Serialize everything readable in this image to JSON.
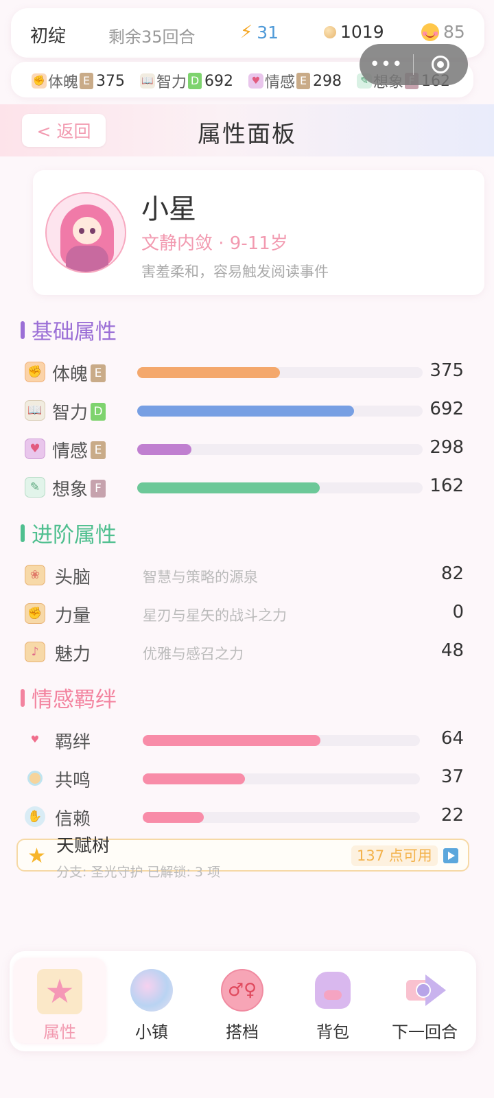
{
  "status": {
    "name": "初绽",
    "rounds": "剩余35回合",
    "energy": "31",
    "coins": "1019",
    "mood": "85"
  },
  "strip": [
    {
      "label": "体魄",
      "grade": "E",
      "value": "375"
    },
    {
      "label": "智力",
      "grade": "D",
      "value": "692"
    },
    {
      "label": "情感",
      "grade": "E",
      "value": "298"
    },
    {
      "label": "想象",
      "grade": "F",
      "value": "162"
    }
  ],
  "header": {
    "back_label": "< 返回",
    "title": "属性面板"
  },
  "profile": {
    "name": "小星",
    "type": "文静内敛 · 9-11岁",
    "desc": "害羞柔和，容易触发阅读事件"
  },
  "basic": {
    "title": "基础属性",
    "rows": [
      {
        "label": "体魄",
        "grade": "E",
        "value": "375",
        "fraction": 0.5
      },
      {
        "label": "智力",
        "grade": "D",
        "value": "692",
        "fraction": 0.76
      },
      {
        "label": "情感",
        "grade": "E",
        "value": "298",
        "fraction": 0.19
      },
      {
        "label": "想象",
        "grade": "F",
        "value": "162",
        "fraction": 0.64
      }
    ]
  },
  "advanced": {
    "title": "进阶属性",
    "rows": [
      {
        "label": "头脑",
        "desc": "智慧与策略的源泉",
        "value": "82"
      },
      {
        "label": "力量",
        "desc": "星刃与星矢的战斗之力",
        "value": "0"
      },
      {
        "label": "魅力",
        "desc": "优雅与感召之力",
        "value": "48"
      }
    ]
  },
  "bonds": {
    "title": "情感羁绊",
    "rows": [
      {
        "label": "羁绊",
        "value": "64",
        "fraction": 0.64
      },
      {
        "label": "共鸣",
        "value": "37",
        "fraction": 0.37
      },
      {
        "label": "信赖",
        "value": "22",
        "fraction": 0.22
      }
    ]
  },
  "talent": {
    "title": "天赋树",
    "sub": "分支: 圣光守护  已解锁: 3 项",
    "badge": "137 点可用"
  },
  "nav": [
    {
      "label": "属性",
      "icon": "star-badge-icon",
      "active": true
    },
    {
      "label": "小镇",
      "icon": "town-icon"
    },
    {
      "label": "搭档",
      "icon": "partners-icon"
    },
    {
      "label": "背包",
      "icon": "backpack-icon"
    },
    {
      "label": "下一回合",
      "icon": "next-round-icon"
    }
  ],
  "colors": {
    "accent_pink": "#f29ab0",
    "bar_physique": "#f4a86c",
    "bar_intellect": "#779fe3",
    "bar_emotion": "#c07fd0",
    "bar_imagination": "#6cc898",
    "bar_bond": "#f88ca8",
    "section_basic": "#9b6fd6",
    "section_advanced": "#4fbf8f",
    "section_bonds": "#f3839f"
  }
}
